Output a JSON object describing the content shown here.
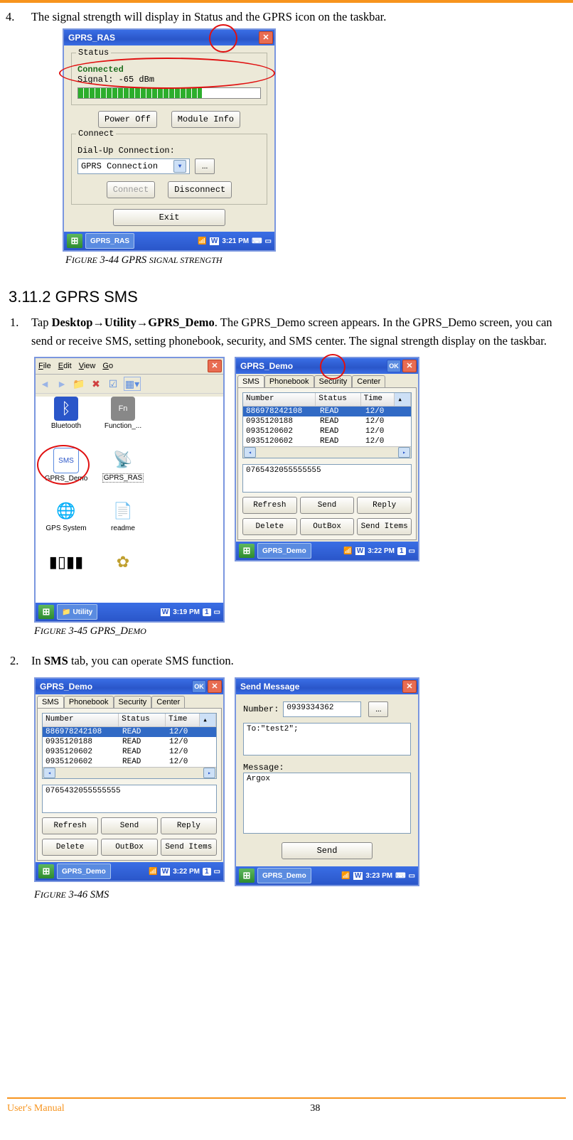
{
  "step4": {
    "num": "4.",
    "text": "The signal strength will display in Status and the GPRS icon on the taskbar."
  },
  "fig44": {
    "caption_prefix": "F",
    "caption_small": "IGURE",
    "caption_rest": " 3-44 GPRS ",
    "caption_small2": "SIGNAL STRENGTH",
    "window": {
      "title": "GPRS_RAS",
      "status_group": "Status",
      "connected": "Connected",
      "signal": "Signal: -65 dBm",
      "power_off": "Power Off",
      "module_info": "Module Info",
      "connect_group": "Connect",
      "dial_label": "Dial-Up Connection:",
      "select_value": "GPRS Connection",
      "connect_btn": "Connect",
      "disconnect_btn": "Disconnect",
      "exit_btn": "Exit",
      "task_label": "GPRS_RAS",
      "time": "3:21 PM"
    }
  },
  "section_heading": "3.11.2  GPRS SMS",
  "step1": {
    "num": "1.",
    "pre": "Tap ",
    "bold": "Desktop→Utility→GPRS_Demo",
    "rest": ". The GPRS_Demo screen appears. In the GPRS_Demo screen, you can send or receive SMS, setting phonebook, security, and SMS center. The signal strength display on the taskbar."
  },
  "fig45": {
    "caption": "FIGURE 3-45 GPRS_DEMO",
    "caption_prefix": "F",
    "caption_small": "IGURE",
    "caption_rest": " 3-45 GPRS_D",
    "caption_small2": "EMO",
    "left": {
      "menu": [
        "File",
        "Edit",
        "View",
        "Go"
      ],
      "icons": {
        "bluetooth": "Bluetooth",
        "function": "Function_...",
        "gprs_demo": "GPRS_Demo",
        "gprs_ras": "GPRS_RAS",
        "gps": "GPS System",
        "readme": "readme"
      },
      "folder_label": "Utility",
      "time": "3:19 PM"
    },
    "right": {
      "title": "GPRS_Demo",
      "tabs": [
        "SMS",
        "Phonebook",
        "Security",
        "Center"
      ],
      "headers": [
        "Number",
        "Status",
        "Time"
      ],
      "rows": [
        {
          "num": "886978242108",
          "status": "READ",
          "time": "12/0"
        },
        {
          "num": "0935120188",
          "status": "READ",
          "time": "12/0"
        },
        {
          "num": "0935120602",
          "status": "READ",
          "time": "12/0"
        },
        {
          "num": "0935120602",
          "status": "READ",
          "time": "12/0"
        }
      ],
      "textarea": "0765432055555555",
      "buttons1": [
        "Refresh",
        "Send",
        "Reply"
      ],
      "buttons2": [
        "Delete",
        "OutBox",
        "Send Items"
      ],
      "task_label": "GPRS_Demo",
      "time": "3:22 PM"
    }
  },
  "step2": {
    "num": "2.",
    "pre": "In ",
    "bold": "SMS",
    "mid": " tab, you can ",
    "op": "operate",
    "rest": " SMS function."
  },
  "fig46": {
    "caption_prefix": "F",
    "caption_small": "IGURE",
    "caption_rest": " 3-46 SMS",
    "left": {
      "title": "GPRS_Demo",
      "tabs": [
        "SMS",
        "Phonebook",
        "Security",
        "Center"
      ],
      "headers": [
        "Number",
        "Status",
        "Time"
      ],
      "rows": [
        {
          "num": "886978242108",
          "status": "READ",
          "time": "12/0"
        },
        {
          "num": "0935120188",
          "status": "READ",
          "time": "12/0"
        },
        {
          "num": "0935120602",
          "status": "READ",
          "time": "12/0"
        },
        {
          "num": "0935120602",
          "status": "READ",
          "time": "12/0"
        }
      ],
      "textarea": "0765432055555555",
      "buttons1": [
        "Refresh",
        "Send",
        "Reply"
      ],
      "buttons2": [
        "Delete",
        "OutBox",
        "Send Items"
      ],
      "task_label": "GPRS_Demo",
      "time": "3:22 PM"
    },
    "right": {
      "title": "Send Message",
      "number_label": "Number:",
      "number_value": "0939334362",
      "to_value": "To:\"test2\";",
      "message_label": "Message:",
      "message_value": "Argox",
      "send_btn": "Send",
      "task_label": "GPRS_Demo",
      "time": "3:23 PM"
    }
  },
  "footer": {
    "left": "User's Manual",
    "page": "38"
  }
}
